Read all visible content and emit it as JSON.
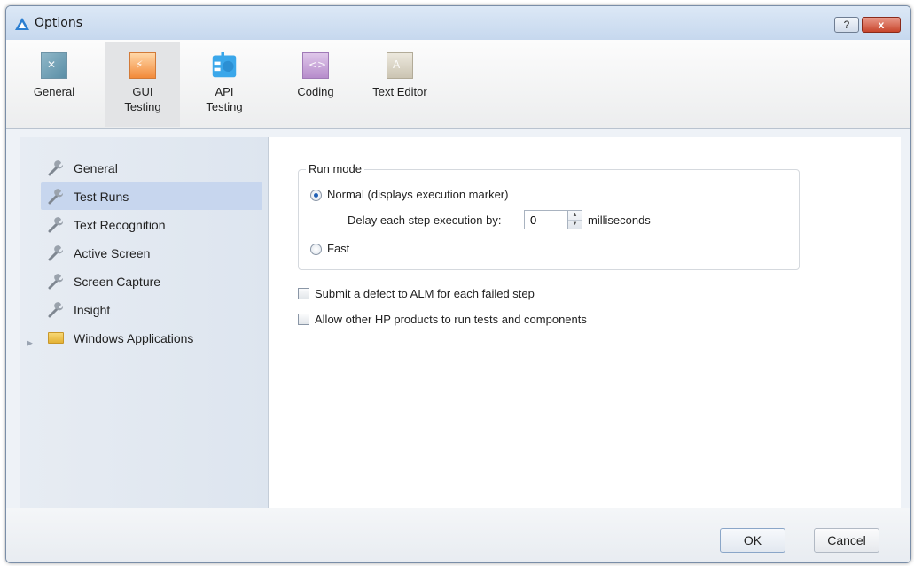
{
  "window": {
    "title": "Options",
    "help_label": "?",
    "close_label": "x"
  },
  "ribbon": {
    "tabs": [
      {
        "label_line1": "General",
        "label_line2": "",
        "icon": "general-tools-icon"
      },
      {
        "label_line1": "GUI",
        "label_line2": "Testing",
        "icon": "gui-testing-icon",
        "active": true
      },
      {
        "label_line1": "API",
        "label_line2": "Testing",
        "icon": "api-testing-icon"
      },
      {
        "label_line1": "Coding",
        "label_line2": "",
        "icon": "coding-icon"
      },
      {
        "label_line1": "Text Editor",
        "label_line2": "",
        "icon": "text-editor-icon"
      }
    ]
  },
  "sidebar": {
    "items": [
      {
        "label": "General",
        "icon": "wrench-icon"
      },
      {
        "label": "Test Runs",
        "icon": "wrench-icon",
        "selected": true
      },
      {
        "label": "Text Recognition",
        "icon": "wrench-icon"
      },
      {
        "label": "Active Screen",
        "icon": "wrench-icon"
      },
      {
        "label": "Screen Capture",
        "icon": "wrench-icon"
      },
      {
        "label": "Insight",
        "icon": "wrench-icon"
      },
      {
        "label": "Windows Applications",
        "icon": "folder-icon",
        "expandable": true
      }
    ]
  },
  "main": {
    "run_mode": {
      "legend": "Run mode",
      "normal_label": "Normal (displays execution marker)",
      "normal_checked": true,
      "delay_label": "Delay each step execution by:",
      "delay_value": "0",
      "delay_unit": "milliseconds",
      "fast_label": "Fast",
      "fast_checked": false
    },
    "submit_defect_label": "Submit a defect to ALM for each failed step",
    "submit_defect_checked": false,
    "allow_hp_label": "Allow other HP products to run tests and components",
    "allow_hp_checked": false
  },
  "footer": {
    "ok_label": "OK",
    "cancel_label": "Cancel"
  },
  "colors": {
    "selection": "#c7d6ee",
    "radio_dot": "#1f5fb4",
    "close_button": "#c8452c"
  }
}
